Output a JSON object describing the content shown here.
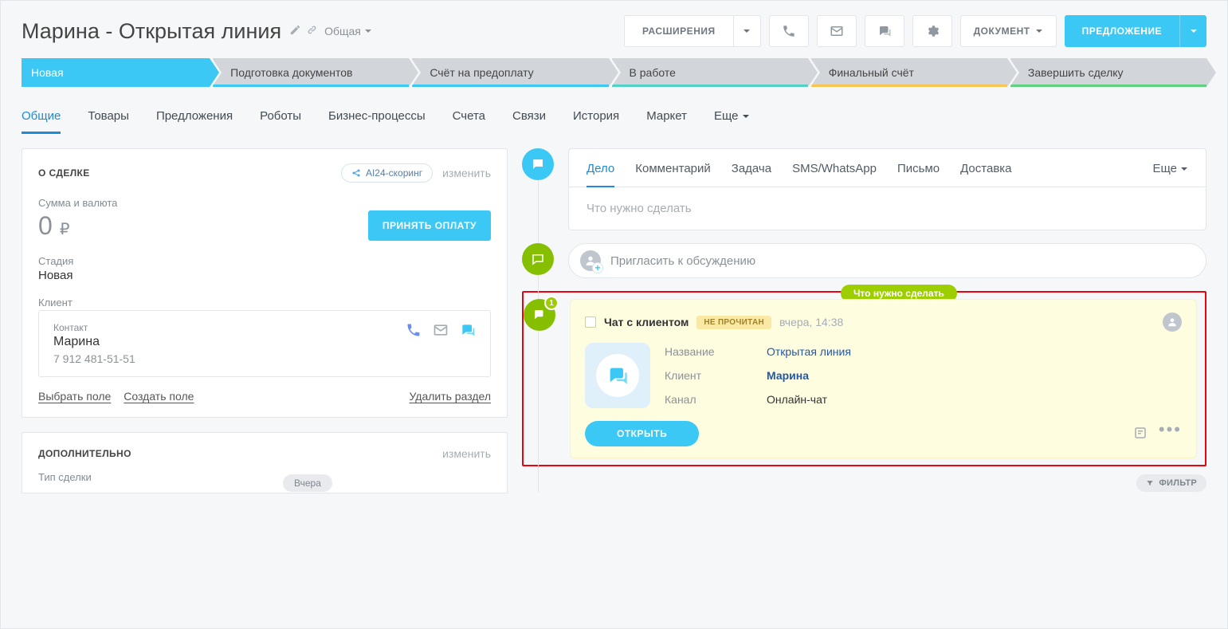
{
  "header": {
    "title": "Марина - Открытая линия",
    "tag": "Общая",
    "extensions": "РАСШИРЕНИЯ",
    "document": "ДОКУМЕНТ",
    "offer": "ПРЕДЛОЖЕНИЕ"
  },
  "stages": {
    "s0": "Новая",
    "s1": "Подготовка документов",
    "s2": "Счёт на предоплату",
    "s3": "В работе",
    "s4": "Финальный счёт",
    "s5": "Завершить сделку"
  },
  "tabs": {
    "common": "Общие",
    "goods": "Товары",
    "offers": "Предложения",
    "robots": "Роботы",
    "bp": "Бизнес-процессы",
    "invoices": "Счета",
    "links": "Связи",
    "history": "История",
    "market": "Маркет",
    "more": "Еще"
  },
  "deal": {
    "section_title": "О СДЕЛКЕ",
    "scoring": "AI24-скоринг",
    "edit": "изменить",
    "amount_label": "Сумма и валюта",
    "amount": "0",
    "currency": "₽",
    "pay": "ПРИНЯТЬ ОПЛАТУ",
    "stage_label": "Стадия",
    "stage_value": "Новая",
    "client_label": "Клиент",
    "contact_label": "Контакт",
    "contact_name": "Марина",
    "contact_phone": "7 912 481-51-51",
    "select_field": "Выбрать поле",
    "create_field": "Создать поле",
    "delete_section": "Удалить раздел"
  },
  "extra": {
    "section_title": "ДОПОЛНИТЕЛЬНО",
    "edit": "изменить",
    "deal_type_label": "Тип сделки"
  },
  "actTabs": {
    "case": "Дело",
    "comment": "Комментарий",
    "task": "Задача",
    "sms": "SMS/WhatsApp",
    "mail": "Письмо",
    "delivery": "Доставка",
    "more": "Еще"
  },
  "timeline": {
    "input_placeholder": "Что нужно сделать",
    "invite": "Пригласить к обсуждению",
    "todo": "Что нужно сделать",
    "chat_title": "Чат с клиентом",
    "unread": "НЕ ПРОЧИТАН",
    "time": "вчера, 14:38",
    "name_label": "Название",
    "name_value": "Открытая линия",
    "client_label": "Клиент",
    "client_value": "Марина",
    "channel_label": "Канал",
    "channel_value": "Онлайн-чат",
    "open": "ОТКРЫТЬ",
    "badge": "1",
    "date": "Вчера",
    "filter": "ФИЛЬТР"
  }
}
